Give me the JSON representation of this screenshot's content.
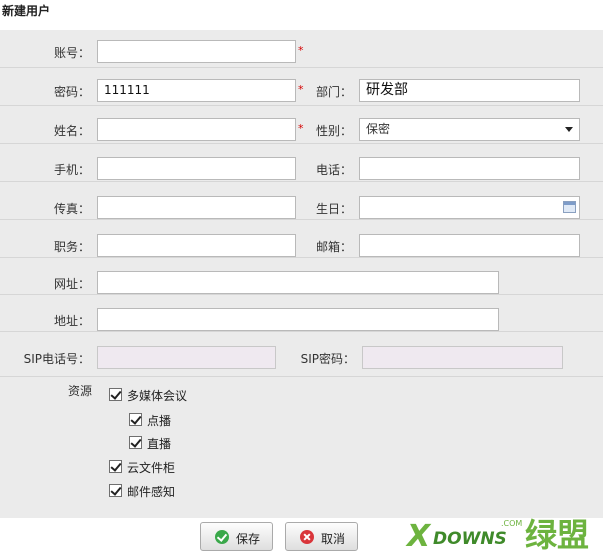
{
  "title": "新建用户",
  "form": {
    "account": {
      "label": "账号：",
      "value": ""
    },
    "password": {
      "label": "密码：",
      "value": "111111"
    },
    "department": {
      "label": "部门：",
      "value": "研发部"
    },
    "name": {
      "label": "姓名：",
      "value": ""
    },
    "gender": {
      "label": "性别：",
      "value": "保密"
    },
    "mobile": {
      "label": "手机：",
      "value": ""
    },
    "phone": {
      "label": "电话：",
      "value": ""
    },
    "fax": {
      "label": "传真：",
      "value": ""
    },
    "birthday": {
      "label": "生日：",
      "value": ""
    },
    "position": {
      "label": "职务：",
      "value": ""
    },
    "email": {
      "label": "邮箱：",
      "value": ""
    },
    "website": {
      "label": "网址：",
      "value": ""
    },
    "address": {
      "label": "地址：",
      "value": ""
    },
    "sip_phone": {
      "label": "SIP电话号：",
      "value": ""
    },
    "sip_password": {
      "label": "SIP密码：",
      "value": ""
    },
    "required_mark": "*"
  },
  "resources": {
    "label": "资源",
    "items": [
      {
        "label": "多媒体会议",
        "checked": true
      },
      {
        "label": "点播",
        "checked": true
      },
      {
        "label": "直播",
        "checked": true
      },
      {
        "label": "云文件柜",
        "checked": true
      },
      {
        "label": "邮件感知",
        "checked": true
      }
    ]
  },
  "buttons": {
    "save": "保存",
    "cancel": "取消"
  },
  "watermark": {
    "text1": "X",
    "text2": "DOWNS",
    "text3": ".COM",
    "text4": "绿盟",
    "color": "#6db33f"
  }
}
